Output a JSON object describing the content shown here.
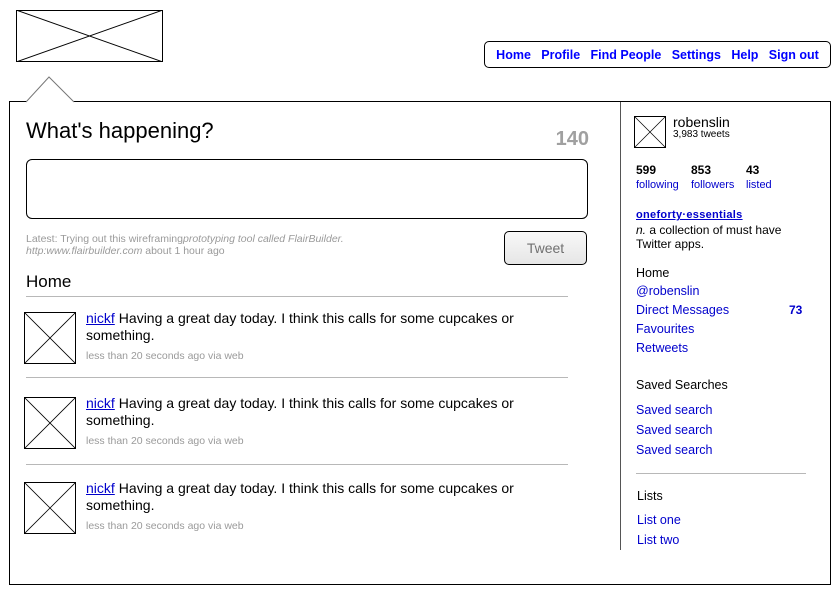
{
  "logo": {
    "icon": "image-placeholder-icon"
  },
  "nav": {
    "items": [
      {
        "label": "Home"
      },
      {
        "label": "Profile"
      },
      {
        "label": "Find People"
      },
      {
        "label": "Settings"
      },
      {
        "label": "Help"
      },
      {
        "label": "Sign out"
      }
    ]
  },
  "composer": {
    "title": "What's happening?",
    "char_count": "140",
    "input_value": "",
    "tweet_button": "Tweet",
    "latest": {
      "prefix": "Latest: Trying out this wireframing",
      "italic1": "prototyping tool called FlairBuilder.",
      "italic2": "http:www.flairbuilder.com",
      "suffix": " about 1 hour ago"
    }
  },
  "timeline": {
    "heading": "Home",
    "tweets": [
      {
        "user": "nickf",
        "text": "Having a great day today. I think this calls for some cupcakes or something.",
        "meta": "less than 20 seconds ago via web"
      },
      {
        "user": "nickf",
        "text": "Having a great day today. I think this calls for some cupcakes or something.",
        "meta": "less than 20 seconds ago via web"
      },
      {
        "user": "nickf",
        "text": "Having a great day today. I think this calls for some cupcakes or something.",
        "meta": "less than 20 seconds ago via web"
      }
    ]
  },
  "sidebar": {
    "profile": {
      "name": "robenslin",
      "tweets": "3,983 tweets"
    },
    "stats": [
      {
        "value": "599",
        "label": "following"
      },
      {
        "value": "853",
        "label": "followers"
      },
      {
        "value": "43",
        "label": "listed"
      }
    ],
    "featured_list": {
      "name": "oneforty·essentials",
      "desc_em": "n.",
      "desc": " a collection of must have Twitter apps."
    },
    "menu": {
      "home": "Home",
      "mentions": "@robenslin",
      "direct_messages": "Direct Messages",
      "dm_count": "73",
      "favourites": "Favourites",
      "retweets": "Retweets"
    },
    "saved_searches": {
      "heading": "Saved Searches",
      "items": [
        "Saved search",
        "Saved search",
        "Saved search"
      ]
    },
    "lists": {
      "heading": "Lists",
      "items": [
        "List one",
        "List two"
      ]
    }
  },
  "colors": {
    "link": "#0000cc",
    "nav_link": "#0000ff",
    "muted": "#9a9a9a",
    "char_count": "#a0a0a0"
  }
}
